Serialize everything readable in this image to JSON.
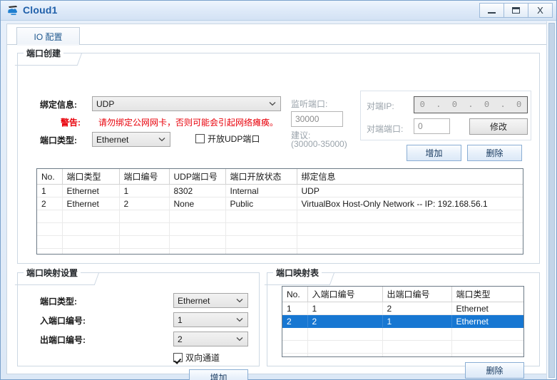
{
  "window": {
    "title": "Cloud1",
    "icon": "cloud-icon",
    "minimize_label": "–",
    "maximize_label": "□",
    "close_label": "X"
  },
  "tabs": [
    {
      "label": "IO 配置",
      "active": true
    }
  ],
  "port_create": {
    "group_title": "端口创建",
    "binding_label": "绑定信息:",
    "binding_value": "UDP",
    "warning_label": "警告:",
    "warning_text": "请勿绑定公网网卡，否则可能会引起网络瘫痪。",
    "port_type_label": "端口类型:",
    "port_type_value": "Ethernet",
    "open_udp_label": "开放UDP端口",
    "open_udp_checked": false,
    "listen_port_label": "监听端口:",
    "listen_port_value": "30000",
    "suggest_label": "建议:",
    "suggest_range": "(30000-35000)",
    "peer_ip_label": "对端IP:",
    "peer_ip_octets": [
      "0",
      "0",
      "0",
      "0"
    ],
    "peer_port_label": "对端端口:",
    "peer_port_value": "0",
    "modify_button": "修改",
    "add_button": "增加",
    "delete_button": "删除"
  },
  "port_table": {
    "headers": [
      "No.",
      "端口类型",
      "端口编号",
      "UDP端口号",
      "端口开放状态",
      "绑定信息"
    ],
    "rows": [
      [
        "1",
        "Ethernet",
        "1",
        "8302",
        "Internal",
        "UDP"
      ],
      [
        "2",
        "Ethernet",
        "2",
        "None",
        "Public",
        "VirtualBox Host-Only Network -- IP: 192.168.56.1"
      ],
      [
        "",
        "",
        "",
        "",
        "",
        ""
      ],
      [
        "",
        "",
        "",
        "",
        "",
        ""
      ],
      [
        "",
        "",
        "",
        "",
        "",
        ""
      ],
      [
        "",
        "",
        "",
        "",
        "",
        ""
      ]
    ]
  },
  "mapping_settings": {
    "group_title": "端口映射设置",
    "port_type_label": "端口类型:",
    "port_type_value": "Ethernet",
    "in_port_label": "入端口编号:",
    "in_port_value": "1",
    "out_port_label": "出端口编号:",
    "out_port_value": "2",
    "bidirectional_label": "双向通道",
    "bidirectional_checked": true,
    "add_button": "增加"
  },
  "mapping_table": {
    "group_title": "端口映射表",
    "headers": [
      "No.",
      "入端口编号",
      "出端口编号",
      "端口类型"
    ],
    "rows": [
      {
        "cells": [
          "1",
          "1",
          "2",
          "Ethernet"
        ],
        "selected": false
      },
      {
        "cells": [
          "2",
          "2",
          "1",
          "Ethernet"
        ],
        "selected": true
      },
      {
        "cells": [
          "",
          "",
          "",
          ""
        ],
        "selected": false
      },
      {
        "cells": [
          "",
          "",
          "",
          ""
        ],
        "selected": false
      },
      {
        "cells": [
          "",
          "",
          "",
          ""
        ],
        "selected": false
      }
    ],
    "delete_button": "删除"
  },
  "colors": {
    "accent": "#1777d2",
    "warning": "#e8000a",
    "title": "#1f5fa9"
  }
}
